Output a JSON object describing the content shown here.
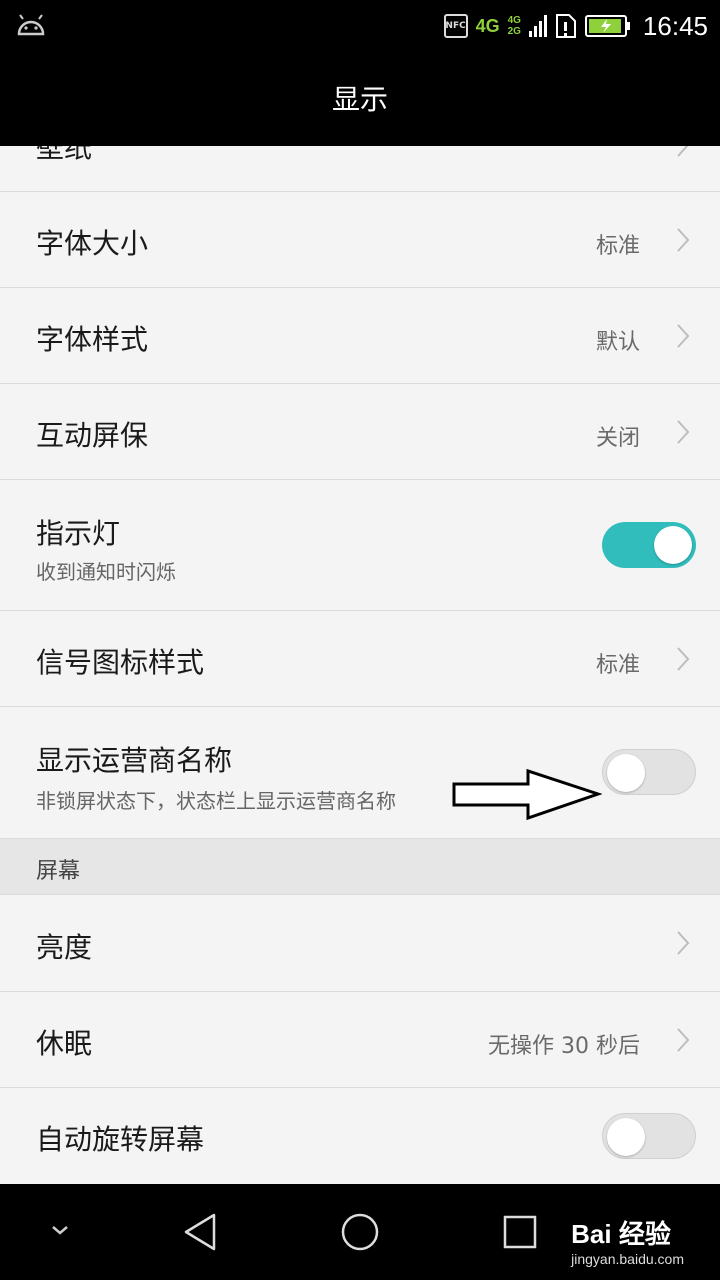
{
  "status_bar": {
    "nfc_label": "NFC",
    "network_primary": "4G",
    "network_secondary_top": "4G",
    "network_secondary_bottom": "2G",
    "time": "16:45",
    "accent_color": "#8fd13b"
  },
  "app_bar": {
    "title": "显示"
  },
  "settings": {
    "partial_top_label": "壁纸",
    "font_size": {
      "label": "字体大小",
      "value": "标准"
    },
    "font_style": {
      "label": "字体样式",
      "value": "默认"
    },
    "screensaver": {
      "label": "互动屏保",
      "value": "关闭"
    },
    "indicator_light": {
      "label": "指示灯",
      "subtitle": "收到通知时闪烁",
      "enabled": true
    },
    "signal_icon_style": {
      "label": "信号图标样式",
      "value": "标准"
    },
    "carrier_name": {
      "label": "显示运营商名称",
      "subtitle": "非锁屏状态下，状态栏上显示运营商名称",
      "enabled": false
    },
    "screen_section": {
      "label": "屏幕"
    },
    "brightness": {
      "label": "亮度"
    },
    "sleep": {
      "label": "休眠",
      "value": "无操作 30 秒后"
    },
    "auto_rotate": {
      "label": "自动旋转屏幕",
      "enabled": false
    }
  },
  "nav_bar": {
    "icons": [
      "chevron-down-icon",
      "back-icon",
      "home-icon",
      "recents-icon"
    ]
  },
  "watermark": {
    "brand": "Bai 经验",
    "url": "jingyan.baidu.com"
  },
  "colors": {
    "toggle_on": "#30bdbc",
    "toggle_off": "#e2e2e2"
  }
}
